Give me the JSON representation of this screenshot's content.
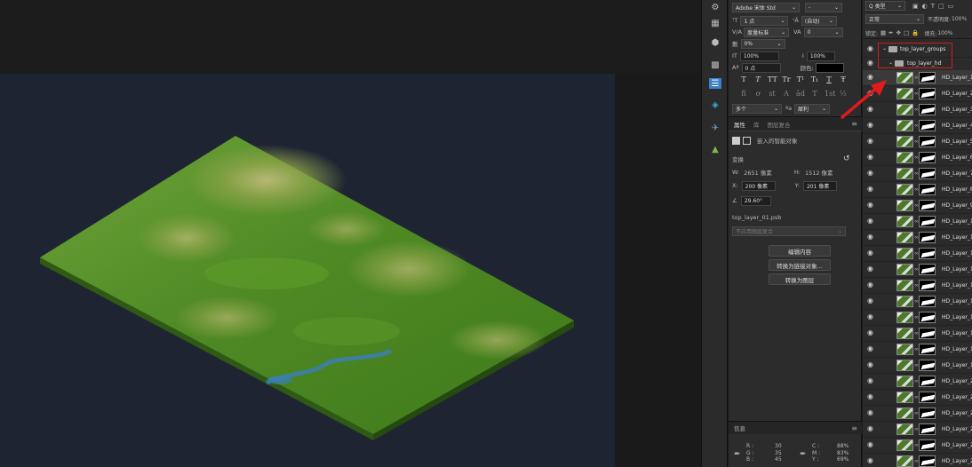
{
  "char_panel": {
    "font_family": "Adobe 宋体 Std",
    "font_style": "-",
    "font_size": "1 点",
    "leading": "(自动)",
    "kerning": "度量标准",
    "tracking": "0",
    "tsume": "0%",
    "vscale": "100%",
    "hscale": "100%",
    "baseline": "0 点",
    "color_label": "颜色:",
    "glyphs_row1": [
      "T",
      "T",
      "TT",
      "Tr",
      "T¹",
      "T₁",
      "T",
      "Ŧ"
    ],
    "glyphs_row2": [
      "fi",
      "ơ",
      "st",
      "A",
      "ād",
      "T",
      "1st",
      "½"
    ],
    "language": "多个",
    "aa_prefix": "ªa",
    "antialias": "犀利"
  },
  "props_panel": {
    "tabs": [
      "属性",
      "库",
      "图层复合"
    ],
    "type_label": "嵌入的智能对象",
    "transform_label": "变换",
    "w_label": "W:",
    "w_value": "2651 像素",
    "h_label": "H:",
    "h_value": "1512 像素",
    "x_label": "X:",
    "x_value": "200 像素",
    "y_label": "Y:",
    "y_value": "201 像素",
    "angle": "29.60°",
    "filename": "top_layer_01.psb",
    "comp_placeholder": "不应用图层复合",
    "buttons": [
      "编辑内容",
      "转换为链接对象...",
      "转换为图层"
    ]
  },
  "info_panel": {
    "title": "信息",
    "rgb_labels": [
      "R :",
      "G :",
      "B :"
    ],
    "rgb_values": [
      "30",
      "35",
      "45"
    ],
    "cmyk_labels": [
      "C :",
      "M :",
      "Y :"
    ],
    "cmyk_values": [
      "88%",
      "83%",
      "69%"
    ]
  },
  "layers_panel": {
    "filter_label": "Q 类型",
    "blend_mode": "正常",
    "opacity_label": "不透明度:",
    "opacity_value": "100%",
    "lock_label": "锁定:",
    "fill_label": "填充:",
    "fill_value": "100%",
    "group_outer": "top_layer_groups",
    "group_inner": "top_layer_hd",
    "layers": [
      "HD_Layer_1",
      "HD_Layer_2",
      "HD_Layer_3",
      "HD_Layer_4",
      "HD_Layer_5",
      "HD_Layer_6",
      "HD_Layer_7",
      "HD_Layer_8",
      "HD_Layer_9",
      "HD_Layer_1",
      "HD_Layer_1",
      "HD_Layer_1",
      "HD_Layer_1",
      "HD_Layer_1",
      "HD_Layer_1",
      "HD_Layer_1",
      "HD_Layer_1",
      "HD_Layer_1",
      "HD_Layer_1",
      "HD_Layer_2",
      "HD_Layer_2",
      "HD_Layer_2",
      "HD_Layer_2",
      "HD_Layer_2",
      "HD_Layer_2"
    ]
  },
  "colors": {
    "canvas_bg": "#1f2433",
    "terrain_green": "#4e8a22",
    "highlight_red": "#d21c1c"
  }
}
